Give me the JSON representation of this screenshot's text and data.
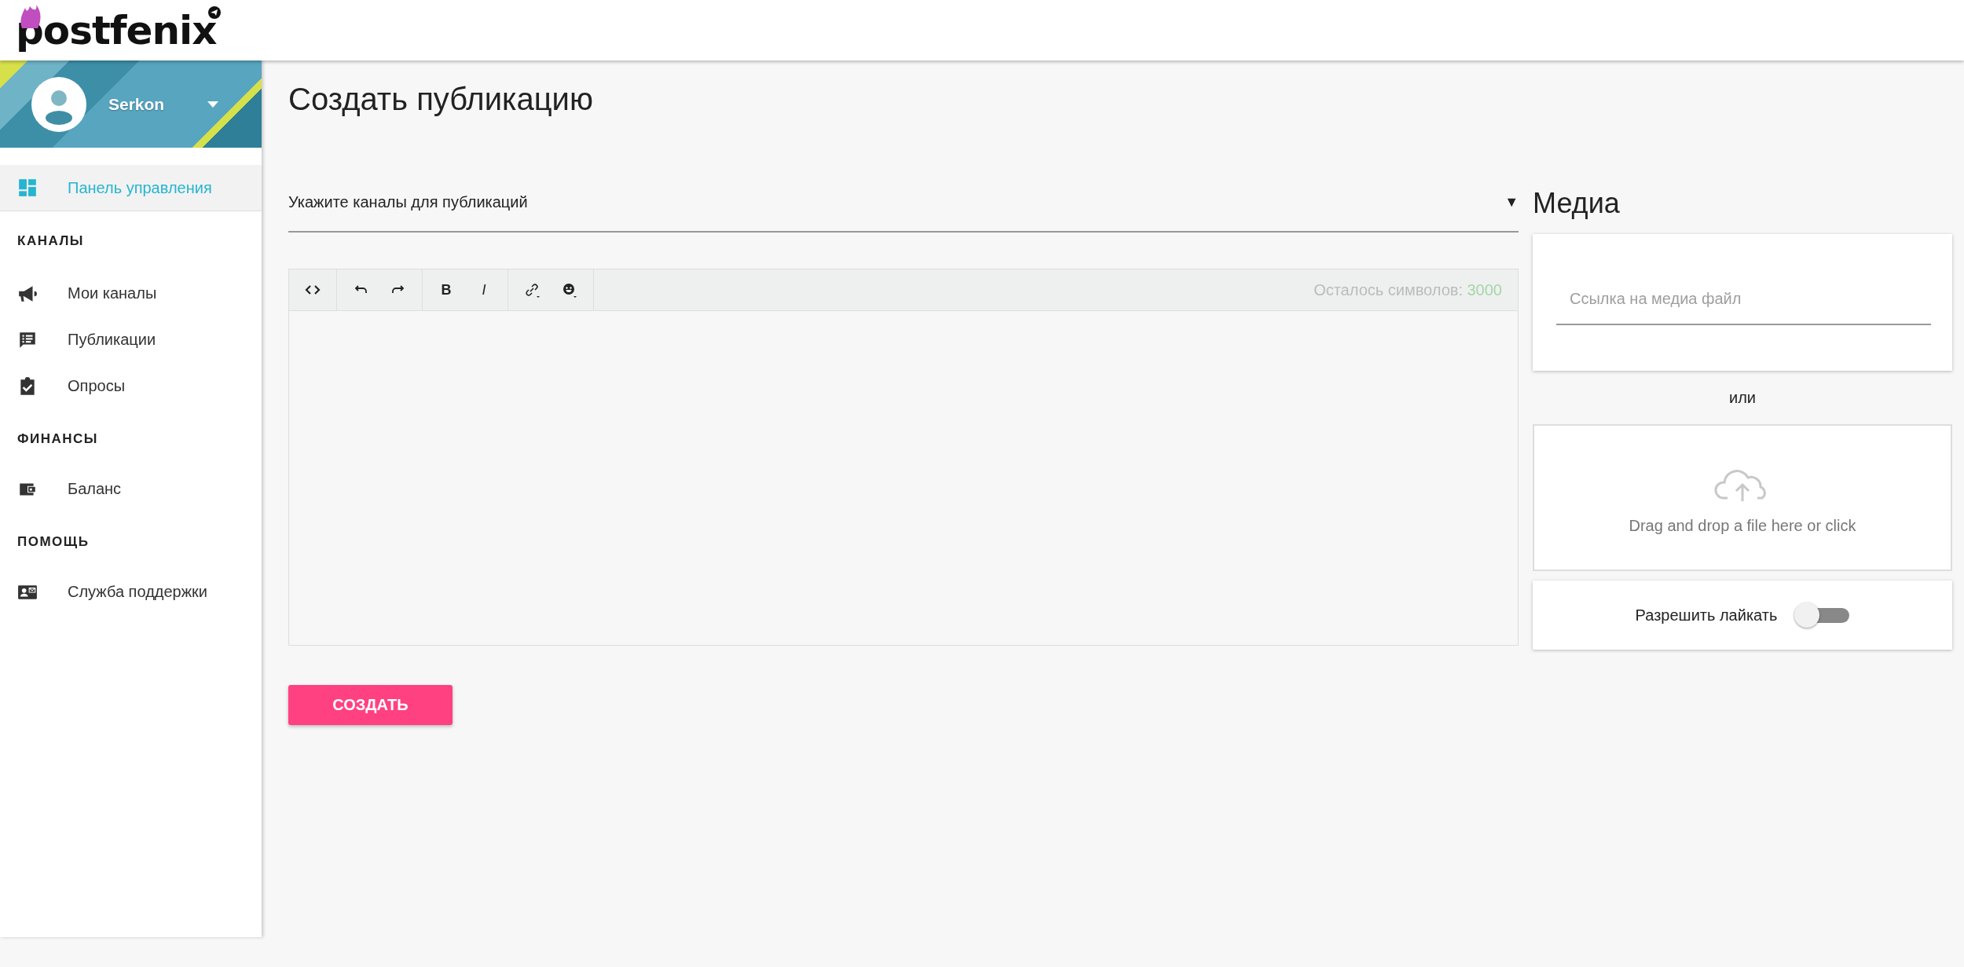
{
  "header": {
    "logo": "postfenix"
  },
  "profile": {
    "name": "Serkon"
  },
  "sidebar": {
    "items": [
      {
        "kind": "link",
        "label": "Панель управления",
        "selected": true
      },
      {
        "kind": "heading",
        "label": "КАНАЛЫ"
      },
      {
        "kind": "link",
        "label": "Мои каналы",
        "selected": false
      },
      {
        "kind": "link",
        "label": "Публикации",
        "selected": false
      },
      {
        "kind": "link",
        "label": "Опросы",
        "selected": false
      },
      {
        "kind": "heading",
        "label": "ФИНАНСЫ"
      },
      {
        "kind": "link",
        "label": "Баланс",
        "selected": false
      },
      {
        "kind": "heading",
        "label": "ПОМОЩЬ"
      },
      {
        "kind": "link",
        "label": "Служба поддержки",
        "selected": false
      }
    ]
  },
  "page_title": "Создать публикацию",
  "channel_select": {
    "placeholder": "Укажите каналы для публикаций",
    "arrow": "▼"
  },
  "editor": {
    "bold": "B",
    "italic": "I",
    "counter_label": "Осталось символов:",
    "counter_value": "3000"
  },
  "submit_button": "СОЗДАТЬ",
  "media": {
    "title": "Медиа",
    "link_field": {
      "placeholder": "Ссылка на медиа файл"
    },
    "separator": "или",
    "dropzone": {
      "text": "Drag and drop a file here or click"
    },
    "allow_likes": {
      "label": "Разрешить лайкать",
      "on": false
    }
  }
}
